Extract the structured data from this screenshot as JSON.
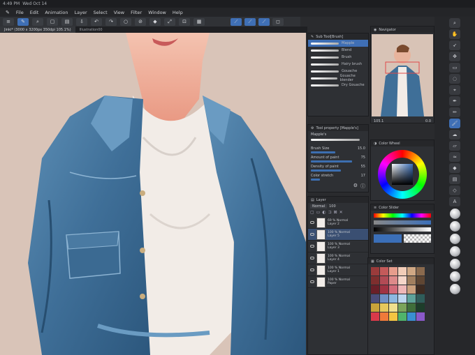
{
  "status": {
    "time": "4:49 PM",
    "date": "Wed Oct 14"
  },
  "menu": [
    "File",
    "Edit",
    "Animation",
    "Layer",
    "Select",
    "View",
    "Filter",
    "Window",
    "Help"
  ],
  "tabs": [
    {
      "label": "Jinki* (3000 x 3200px 350dpi 105.1%)",
      "active": true
    },
    {
      "label": "Illustration00",
      "active": false
    }
  ],
  "subtool_panel": {
    "title": "Sub Tool[Brush]",
    "brushes": [
      "Mapple",
      "Blend",
      "Brush",
      "Hairy brush",
      "Gouache",
      "Gouache blender",
      "Dry Gouache"
    ]
  },
  "tool_property": {
    "title": "Tool property [Mapple's]",
    "brush_name": "Mapple's",
    "properties": [
      {
        "label": "Brush Size",
        "value": "15.0",
        "level": 0.45
      },
      {
        "label": "Amount of paint",
        "value": "75",
        "level": 0.75
      },
      {
        "label": "Density of paint",
        "value": "55",
        "level": 0.55
      },
      {
        "label": "Color stretch",
        "value": "17",
        "level": 0.17
      }
    ]
  },
  "layer_panel": {
    "title": "Layer",
    "blend_mode": "Normal",
    "opacity": "100",
    "layers": [
      {
        "opacity": "69 %",
        "mode": "Normal",
        "name": "Layer 2",
        "selected": false
      },
      {
        "opacity": "100 %",
        "mode": "Normal",
        "name": "Layer 5",
        "selected": true
      },
      {
        "opacity": "100 %",
        "mode": "Normal",
        "name": "Layer 3",
        "selected": false
      },
      {
        "opacity": "100 %",
        "mode": "Normal",
        "name": "Layer 4",
        "selected": false
      },
      {
        "opacity": "100 %",
        "mode": "Normal",
        "name": "Layer 1",
        "selected": false
      },
      {
        "opacity": "100 %",
        "mode": "Normal",
        "name": "Paper",
        "selected": false
      }
    ]
  },
  "navigator": {
    "title": "Navigator",
    "zoom": "105.1",
    "angle": "0.0"
  },
  "color_panels": {
    "wheel_title": "Color Wheel",
    "slider_title": "Color Slider",
    "set_title": "Color Set"
  },
  "colors": {
    "accent": "#3f6fb5",
    "swatches": [
      "#9a3b3b",
      "#c45a5a",
      "#e79d8c",
      "#f2cdb8",
      "#d0a884",
      "#8a6a4e",
      "#7e2e2e",
      "#b24b55",
      "#dd8a8a",
      "#f5d6c9",
      "#a17f5f",
      "#5f4633",
      "#6a1f28",
      "#a03342",
      "#d26c7a",
      "#efb7b7",
      "#caa07d",
      "#3d2b21",
      "#4b4d7a",
      "#6f8fc4",
      "#8db8e0",
      "#bcd6ee",
      "#5ea39a",
      "#2f5d5a",
      "#c9a23a",
      "#e6c85c",
      "#f1e08e",
      "#7aa35a",
      "#3f6e3a",
      "#1d3d2a",
      "#d93a4a",
      "#f07a3a",
      "#f4c542",
      "#4fb36b",
      "#3a8fd1",
      "#8a59c9"
    ]
  },
  "toolbar_icons": [
    "menu-icon",
    "pen-icon",
    "magnifier-icon",
    "save-icon",
    "undo-icon",
    "redo-icon",
    "transform-icon",
    "fill-icon",
    "snap-icon"
  ]
}
